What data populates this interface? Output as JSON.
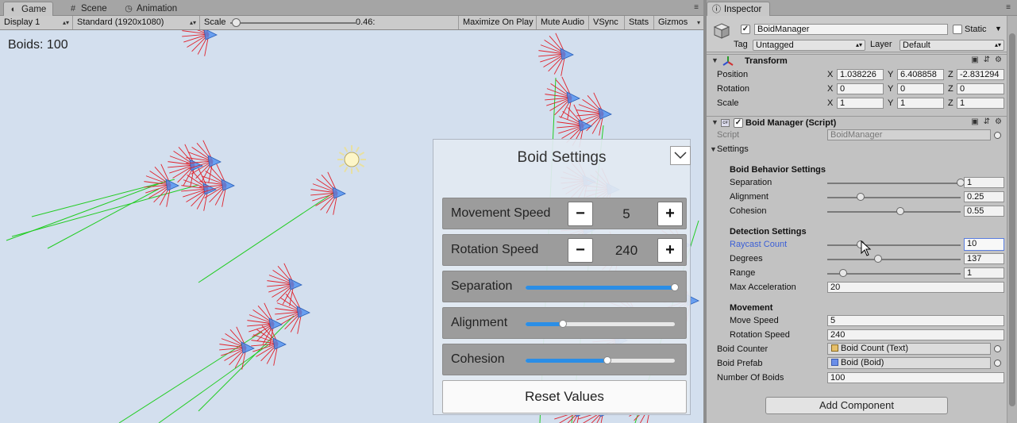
{
  "game": {
    "tabs": [
      {
        "label": "Game",
        "icon": "gamepad-icon",
        "active": true
      },
      {
        "label": "Scene",
        "icon": "grid-icon",
        "active": false
      },
      {
        "label": "Animation",
        "icon": "clock-icon",
        "active": false
      }
    ],
    "toolbar": {
      "display": "Display 1",
      "resolution": "Standard (1920x1080)",
      "scale_label": "Scale",
      "scale_value": "0.46:",
      "maximize": "Maximize On Play",
      "mute": "Mute Audio",
      "vsync": "VSync",
      "stats": "Stats",
      "gizmos": "Gizmos"
    },
    "boids_counter": "Boids: 100",
    "settings_panel": {
      "title": "Boid Settings",
      "movement_speed": {
        "label": "Movement Speed",
        "value": "5"
      },
      "rotation_speed": {
        "label": "Rotation Speed",
        "value": "240"
      },
      "separation": {
        "label": "Separation",
        "level": 1.0
      },
      "alignment": {
        "label": "Alignment",
        "level": 0.25
      },
      "cohesion": {
        "label": "Cohesion",
        "level": 0.55
      },
      "reset_label": "Reset Values",
      "minus": "−",
      "plus": "+"
    },
    "colors": {
      "sky": "#d3dfee",
      "boid": "#4d8ff0",
      "ray_red": "#e0202a",
      "ray_green": "#22cc22",
      "slider_fill": "#2b8ee6"
    }
  },
  "inspector": {
    "tab_label": "Inspector",
    "object": {
      "name": "BoidManager",
      "static_label": "Static",
      "tag_label": "Tag",
      "tag_value": "Untagged",
      "layer_label": "Layer",
      "layer_value": "Default"
    },
    "transform": {
      "title": "Transform",
      "position": {
        "label": "Position",
        "x": "1.038226",
        "y": "6.408858",
        "z": "-2.831294"
      },
      "rotation": {
        "label": "Rotation",
        "x": "0",
        "y": "0",
        "z": "0"
      },
      "scale": {
        "label": "Scale",
        "x": "1",
        "y": "1",
        "z": "1"
      },
      "axis_x": "X",
      "axis_y": "Y",
      "axis_z": "Z"
    },
    "boid_manager": {
      "title": "Boid Manager (Script)",
      "script_label": "Script",
      "script_value": "BoidManager",
      "settings_label": "Settings",
      "behavior_header": "Boid Behavior Settings",
      "separation": {
        "label": "Separation",
        "value": "1",
        "level": 1.0
      },
      "alignment": {
        "label": "Alignment",
        "value": "0.25",
        "level": 0.25
      },
      "cohesion": {
        "label": "Cohesion",
        "value": "0.55",
        "level": 0.55
      },
      "detection_header": "Detection Settings",
      "raycast_count": {
        "label": "Raycast Count",
        "value": "10",
        "level": 0.25
      },
      "degrees": {
        "label": "Degrees",
        "value": "137",
        "level": 0.38
      },
      "range": {
        "label": "Range",
        "value": "1",
        "level": 0.12
      },
      "max_acceleration": {
        "label": "Max Acceleration",
        "value": "20"
      },
      "movement_header": "Movement",
      "move_speed": {
        "label": "Move Speed",
        "value": "5"
      },
      "rotation_speed": {
        "label": "Rotation Speed",
        "value": "240"
      },
      "boid_counter": {
        "label": "Boid Counter",
        "value": "Boid Count (Text)"
      },
      "boid_prefab": {
        "label": "Boid Prefab",
        "value": "Boid (Boid)"
      },
      "number_of_boids": {
        "label": "Number Of Boids",
        "value": "100"
      }
    },
    "add_component": "Add Component"
  }
}
